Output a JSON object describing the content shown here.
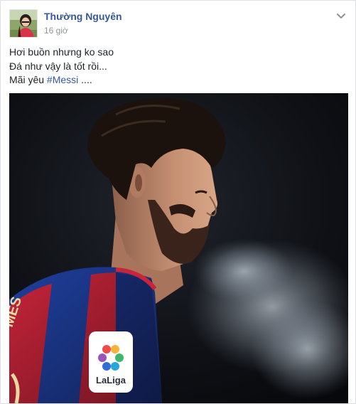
{
  "post": {
    "author_name": "Thường Nguyên",
    "timestamp": "16 giờ",
    "options_icon": "chevron-down-icon",
    "text_lines": [
      "Hơi buồn nhưng ko sao",
      "Đá như vậy là tốt rồi..."
    ],
    "last_line_prefix": "Mãi yêu ",
    "hashtag": "#Messi",
    "last_line_suffix": " ....",
    "photo": {
      "badge_text": "LaLiga",
      "jersey_text": "MES"
    }
  },
  "colors": {
    "link": "#365899",
    "text": "#1d2129",
    "meta": "#90949c",
    "jersey_blue": "#1f3f9e",
    "jersey_red": "#c8243a"
  }
}
